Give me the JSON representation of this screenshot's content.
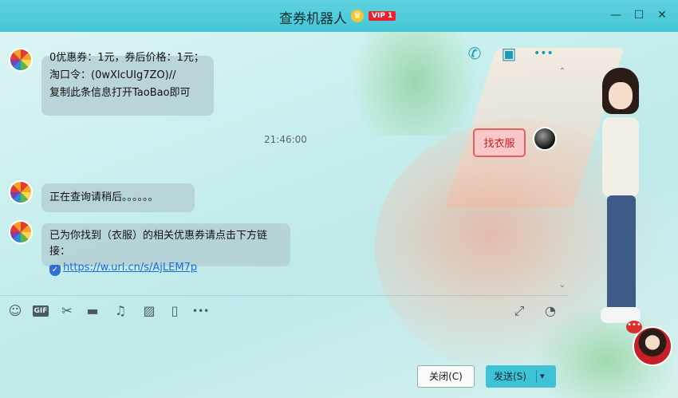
{
  "window": {
    "title": "查券机器人",
    "vip_label": "VIP 1",
    "crown_icon": "crown-icon",
    "controls": {
      "minimize": "—",
      "maximize": "☐",
      "close": "✕"
    }
  },
  "call_icons": {
    "phone": "✆",
    "video": "▣",
    "more": "•••"
  },
  "chat": {
    "bubble_1": {
      "line1": "0优惠券：1元，券后价格：1元；",
      "line2": "淘口令：(0wXlcUIg7ZO)//",
      "line3": "复制此条信息打开TaoBao即可"
    },
    "sent_message": "找衣服",
    "timestamp": "21:46:00",
    "bubble_2": "正在查询请稍后。。。。。。",
    "bubble_3_text": "已为你找到（衣服）的相关优惠券请点击下方链接：",
    "bubble_3_link": "https://w.url.cn/s/AjLEM7p",
    "scroll_up": "⌃",
    "scroll_down": "⌄"
  },
  "toolbar": {
    "emoji": "☺",
    "gif": "GIF",
    "scissors": "✂",
    "folder": "▬",
    "music": "♫",
    "image": "▨",
    "shake": "▯",
    "more": "•••",
    "expand": "⤢",
    "history": "◔"
  },
  "buttons": {
    "close": "关闭(C)",
    "send": "发送(S)",
    "send_dropdown": "▾"
  },
  "notification_badge": "•••",
  "colors": {
    "titlebar": "#45c6d6",
    "send_button": "#3fc2d6",
    "link": "#1d6cd6",
    "sent_bubble_border": "#e16064"
  }
}
